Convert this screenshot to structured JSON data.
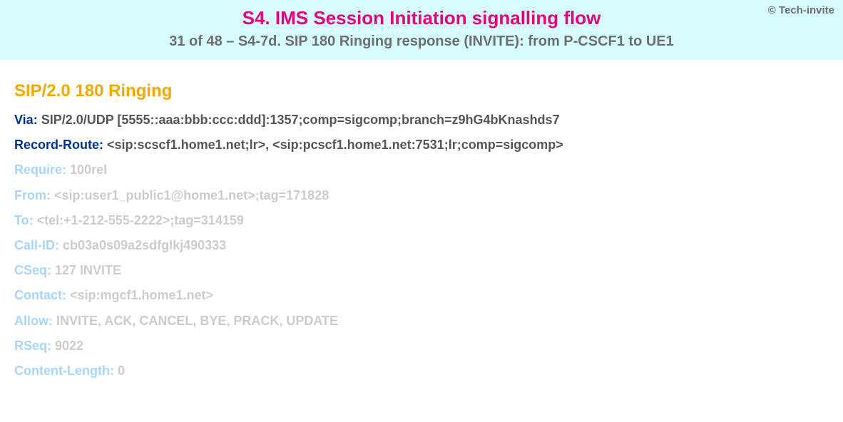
{
  "header": {
    "copyright": "© Tech-invite",
    "title": "S4. IMS Session Initiation signalling flow",
    "subtitle": "31 of 48 – S4-7d. SIP 180 Ringing response (INVITE): from P-CSCF1 to UE1"
  },
  "sip": {
    "status_line": "SIP/2.0 180 Ringing",
    "headers": [
      {
        "name": "Via",
        "value": "SIP/2.0/UDP [5555::aaa:bbb:ccc:ddd]:1357;comp=sigcomp;branch=z9hG4bKnashds7",
        "emphasis": "dark"
      },
      {
        "name": "Record-Route",
        "value": "<sip:scscf1.home1.net;lr>, <sip:pcscf1.home1.net:7531;lr;comp=sigcomp>",
        "emphasis": "dark"
      },
      {
        "name": "Require",
        "value": "100rel",
        "emphasis": "light"
      },
      {
        "name": "From",
        "value": "<sip:user1_public1@home1.net>;tag=171828",
        "emphasis": "light"
      },
      {
        "name": "To",
        "value": "<tel:+1-212-555-2222>;tag=314159",
        "emphasis": "light"
      },
      {
        "name": "Call-ID",
        "value": "cb03a0s09a2sdfglkj490333",
        "emphasis": "light"
      },
      {
        "name": "CSeq",
        "value": "127 INVITE",
        "emphasis": "light"
      },
      {
        "name": "Contact",
        "value": "<sip:mgcf1.home1.net>",
        "emphasis": "light"
      },
      {
        "name": "Allow",
        "value": "INVITE, ACK, CANCEL, BYE, PRACK, UPDATE",
        "emphasis": "light"
      },
      {
        "name": "RSeq",
        "value": "9022",
        "emphasis": "light"
      },
      {
        "name": "Content-Length",
        "value": "0",
        "emphasis": "light"
      }
    ]
  }
}
